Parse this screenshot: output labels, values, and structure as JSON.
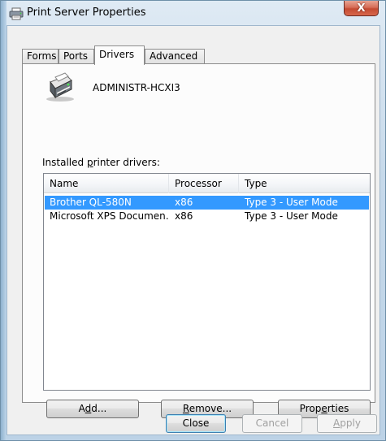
{
  "window": {
    "title": "Print Server Properties",
    "close_glyph": "X",
    "title_icon": "printer-icon"
  },
  "tabs": [
    {
      "label": "Forms"
    },
    {
      "label": "Ports"
    },
    {
      "label": "Drivers",
      "active": true
    },
    {
      "label": "Advanced"
    }
  ],
  "drivers_panel": {
    "server_name": "ADMINISTR-HCXI3",
    "server_icon": "printer-icon",
    "installed_label_pre": "Installed ",
    "installed_label_u": "p",
    "installed_label_post": "rinter drivers:",
    "columns": [
      "Name",
      "Processor",
      "Type"
    ],
    "rows": [
      {
        "name": "Brother QL-580N",
        "processor": "x86",
        "type": "Type 3 - User Mode",
        "selected": true
      },
      {
        "name": "Microsoft XPS Documen…",
        "processor": "x86",
        "type": "Type 3 - User Mode",
        "selected": false
      }
    ],
    "buttons": {
      "add_pre": "A",
      "add_u": "d",
      "add_post": "d...",
      "remove_pre": "",
      "remove_u": "R",
      "remove_post": "emove...",
      "properties_pre": "Prop",
      "properties_u": "e",
      "properties_post": "rties"
    }
  },
  "footer": {
    "close_label": "Close",
    "cancel_label": "Cancel",
    "apply_pre": "",
    "apply_u": "A",
    "apply_post": "pply"
  },
  "colors": {
    "selection": "#3399ff",
    "close_button": "#c44a32",
    "dialog_bg": "#f0f0f0"
  }
}
